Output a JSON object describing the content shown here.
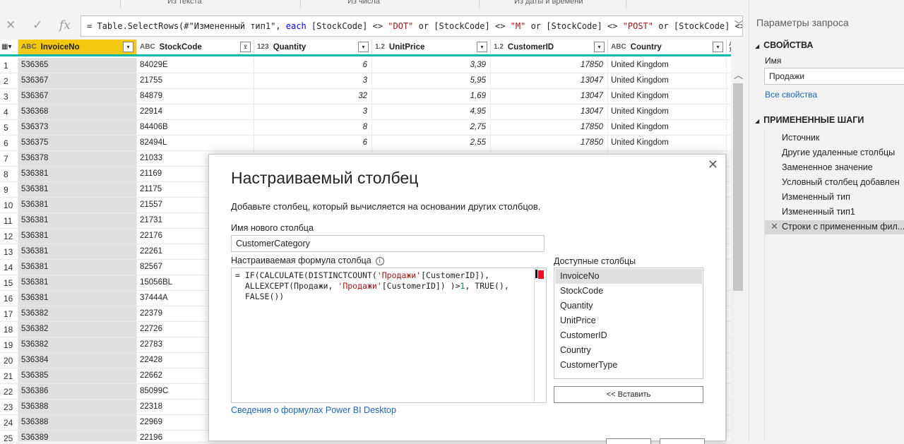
{
  "ribbon": {
    "items": [
      "Из текста",
      "Из числа",
      "Из даты и времени"
    ]
  },
  "formula_bar": {
    "cancel_icon": "x-icon",
    "confirm_icon": "check-icon",
    "fx_label": "fx",
    "parts": [
      {
        "t": "= Table.SelectRows(#\"Измененный тип1\", ",
        "c": "n"
      },
      {
        "t": "each",
        "c": "kw"
      },
      {
        "t": " [StockCode] <> ",
        "c": "n"
      },
      {
        "t": "\"DOT\"",
        "c": "str"
      },
      {
        "t": " or [StockCode] <> ",
        "c": "n"
      },
      {
        "t": "\"M\"",
        "c": "str"
      },
      {
        "t": " or [StockCode] <> ",
        "c": "n"
      },
      {
        "t": "\"POST\"",
        "c": "str"
      },
      {
        "t": " or [StockCode] <>",
        "c": "n"
      }
    ]
  },
  "grid": {
    "columns": [
      {
        "type": "ABC",
        "name": "InvoiceNo"
      },
      {
        "type": "ABC",
        "name": "StockCode"
      },
      {
        "type": "123",
        "name": "Quantity"
      },
      {
        "type": "1.2",
        "name": "UnitPrice"
      },
      {
        "type": "1.2",
        "name": "CustomerID"
      },
      {
        "type": "ABC",
        "name": "Country"
      },
      {
        "type": "ABC 123",
        "name": ""
      }
    ],
    "rows": [
      [
        "1",
        "536365",
        "84029E",
        "6",
        "3,39",
        "17850",
        "United Kingdom"
      ],
      [
        "2",
        "536367",
        "21755",
        "3",
        "5,95",
        "13047",
        "United Kingdom"
      ],
      [
        "3",
        "536367",
        "84879",
        "32",
        "1,69",
        "13047",
        "United Kingdom"
      ],
      [
        "4",
        "536368",
        "22914",
        "3",
        "4,95",
        "13047",
        "United Kingdom"
      ],
      [
        "5",
        "536373",
        "84406B",
        "8",
        "2,75",
        "17850",
        "United Kingdom"
      ],
      [
        "6",
        "536375",
        "82494L",
        "6",
        "2,55",
        "17850",
        "United Kingdom"
      ],
      [
        "7",
        "536378",
        "21033",
        "",
        "",
        "",
        ""
      ],
      [
        "8",
        "536381",
        "21169",
        "",
        "",
        "",
        ""
      ],
      [
        "9",
        "536381",
        "21175",
        "",
        "",
        "",
        ""
      ],
      [
        "10",
        "536381",
        "21557",
        "",
        "",
        "",
        ""
      ],
      [
        "11",
        "536381",
        "21731",
        "",
        "",
        "",
        ""
      ],
      [
        "12",
        "536381",
        "22176",
        "",
        "",
        "",
        ""
      ],
      [
        "13",
        "536381",
        "22261",
        "",
        "",
        "",
        ""
      ],
      [
        "14",
        "536381",
        "82567",
        "",
        "",
        "",
        ""
      ],
      [
        "15",
        "536381",
        "15056BL",
        "",
        "",
        "",
        ""
      ],
      [
        "16",
        "536381",
        "37444A",
        "",
        "",
        "",
        ""
      ],
      [
        "17",
        "536382",
        "22379",
        "",
        "",
        "",
        ""
      ],
      [
        "18",
        "536382",
        "22726",
        "",
        "",
        "",
        ""
      ],
      [
        "19",
        "536382",
        "22783",
        "",
        "",
        "",
        ""
      ],
      [
        "20",
        "536384",
        "22428",
        "",
        "",
        "",
        ""
      ],
      [
        "21",
        "536385",
        "22662",
        "",
        "",
        "",
        ""
      ],
      [
        "22",
        "536386",
        "85099C",
        "",
        "",
        "",
        ""
      ],
      [
        "23",
        "536388",
        "22318",
        "",
        "",
        "",
        ""
      ],
      [
        "24",
        "536388",
        "22969",
        "",
        "",
        "",
        ""
      ],
      [
        "25",
        "536389",
        "22196",
        "",
        "",
        "",
        ""
      ]
    ]
  },
  "query_panel": {
    "title": "Параметры запроса",
    "properties_header": "СВОЙСТВА",
    "name_label": "Имя",
    "name_value": "Продажи",
    "all_props_link": "Все свойства",
    "steps_header": "ПРИМЕНЕННЫЕ ШАГИ",
    "steps": [
      "Источник",
      "Другие удаленные столбцы",
      "Замененное значение",
      "Условный столбец добавлен",
      "Измененный тип",
      "Измененный тип1",
      "Строки с примененным фил..."
    ]
  },
  "dialog": {
    "title": "Настраиваемый столбец",
    "description": "Добавьте столбец, который вычисляется на основании других столбцов.",
    "new_col_label": "Имя нового столбца",
    "new_col_value": "CustomerCategory",
    "formula_label": "Настраиваемая формула столбца",
    "formula_lines": [
      [
        {
          "t": "= IF(CALCULATE(DISTINCTCOUNT(",
          "c": "n"
        },
        {
          "t": "'Продажи'",
          "c": "str"
        },
        {
          "t": "[CustomerID]),",
          "c": "n"
        }
      ],
      [
        {
          "t": "  ALLEXCEPT(Продажи, ",
          "c": "n"
        },
        {
          "t": "'Продажи'",
          "c": "str"
        },
        {
          "t": "[CustomerID]) )>",
          "c": "n"
        },
        {
          "t": "1",
          "c": "num"
        },
        {
          "t": ", TRUE(),",
          "c": "n"
        }
      ],
      [
        {
          "t": "  FALSE())",
          "c": "n"
        }
      ]
    ],
    "available_label": "Доступные столбцы",
    "available_columns": [
      "InvoiceNo",
      "StockCode",
      "Quantity",
      "UnitPrice",
      "CustomerID",
      "Country",
      "CustomerType"
    ],
    "insert_button": "<< Вставить",
    "help_link": "Сведения о формулах Power BI Desktop"
  }
}
